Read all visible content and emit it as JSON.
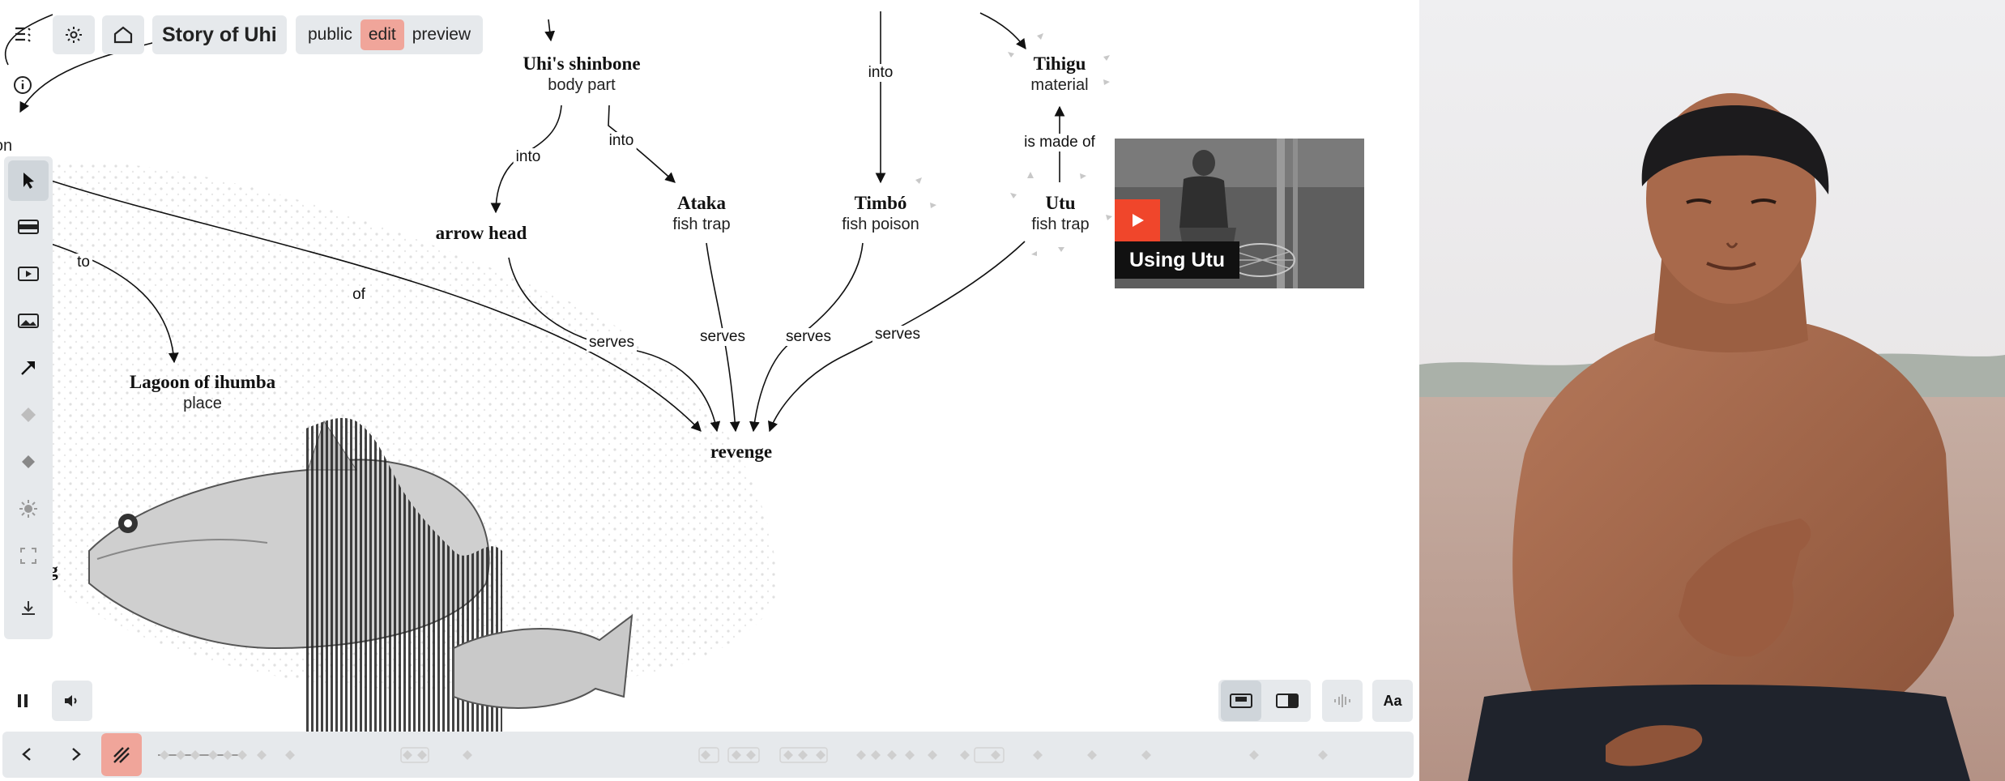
{
  "header": {
    "title": "Story of Uhi",
    "modes": [
      "public",
      "edit",
      "preview"
    ],
    "active_mode": "edit"
  },
  "graph": {
    "nodes": {
      "uhi_shinbone": {
        "title": "Uhi's shinbone",
        "subtitle": "body part"
      },
      "tihigu": {
        "title": "Tihigu",
        "subtitle": "material"
      },
      "ataka": {
        "title": "Ataka",
        "subtitle": "fish trap"
      },
      "timbo": {
        "title": "Timbó",
        "subtitle": "fish poison"
      },
      "utu": {
        "title": "Utu",
        "subtitle": "fish trap"
      },
      "arrow_head": {
        "title": "arrow head",
        "subtitle": ""
      },
      "lagoon": {
        "title": "Lagoon of ihumba",
        "subtitle": "place"
      },
      "revenge": {
        "title": "revenge",
        "subtitle": ""
      },
      "edge_clip_on": "on",
      "edge_clip_g": "g"
    },
    "edges": {
      "into_1": "into",
      "into_2": "into",
      "into_3": "into",
      "is_made_of": "is made of",
      "to": "to",
      "of": "of",
      "serves_1": "serves",
      "serves_2": "serves",
      "serves_3": "serves",
      "serves_4": "serves"
    }
  },
  "media_card": {
    "caption": "Using Utu"
  },
  "toolbar": {
    "tools": [
      "select-icon",
      "card-icon",
      "video-icon",
      "image-icon",
      "arrow-icon",
      "blur-icon",
      "diamond-icon",
      "sun-icon",
      "frame-icon",
      "download-icon"
    ]
  },
  "bottom": {
    "font_button": "Aa"
  },
  "colors": {
    "accent": "#f0a59a",
    "chip": "#e6e9ec",
    "play": "#f0462b"
  }
}
